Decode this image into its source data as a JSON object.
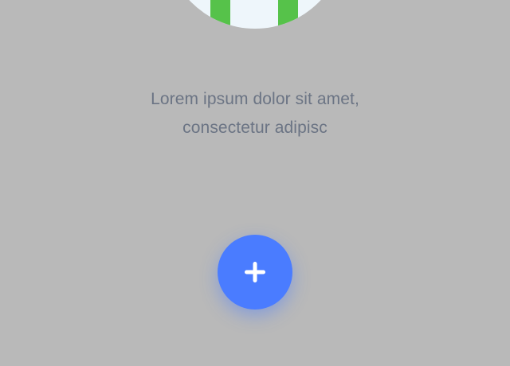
{
  "message": {
    "line1": "Lorem ipsum dolor sit amet,",
    "line2": "consectetur adipisc"
  },
  "fab": {
    "icon": "plus-icon",
    "color": "#4a7cff"
  },
  "illustration": {
    "stripe_color": "#56c24a",
    "fill_color": "#eef6fb"
  },
  "colors": {
    "background": "#b9b9b9",
    "text": "#6b7484"
  }
}
